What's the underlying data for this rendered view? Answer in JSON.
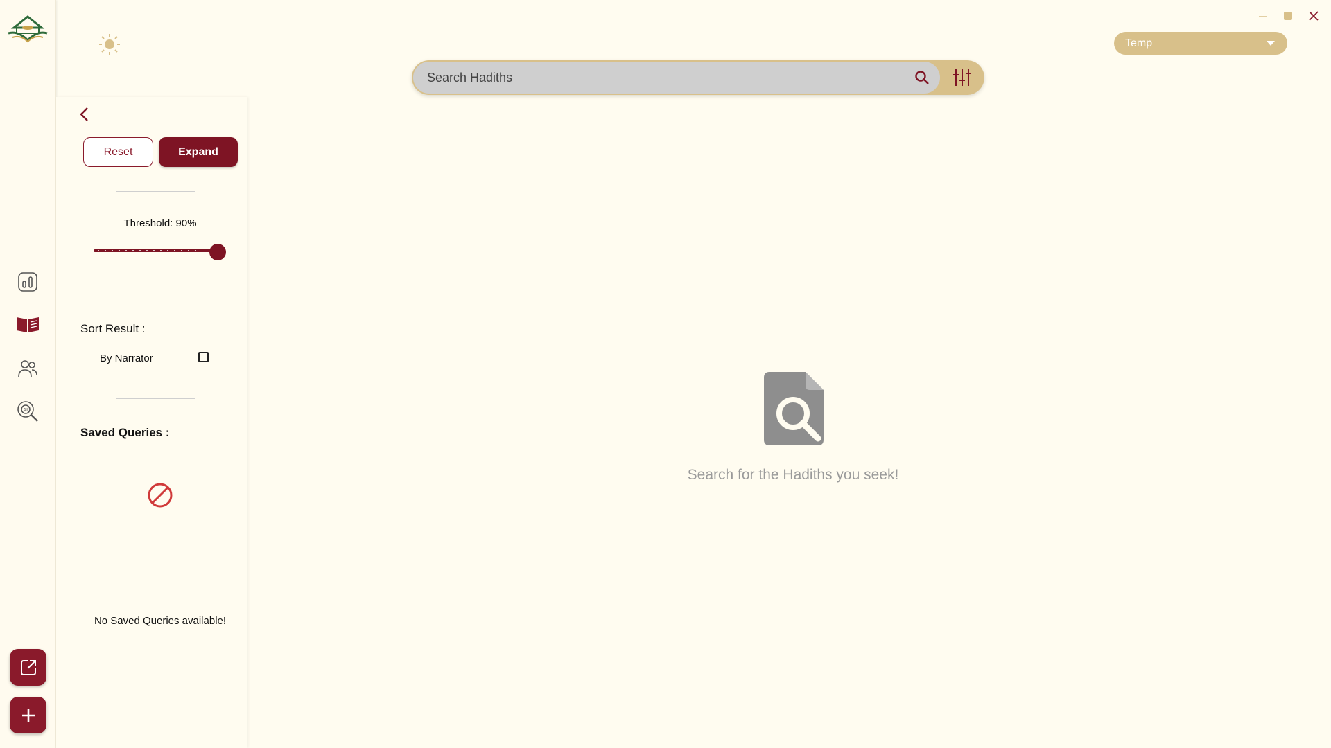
{
  "rail": {
    "items": [
      {
        "name": "statistics-icon"
      },
      {
        "name": "book-icon"
      },
      {
        "name": "narrators-icon"
      },
      {
        "name": "ai-search-icon"
      }
    ],
    "fab_open_icon": "external-link-icon",
    "fab_add_icon": "plus-icon"
  },
  "top": {
    "theme_icon": "sun-icon",
    "dropdown_value": "Temp"
  },
  "search": {
    "placeholder": "Search Hadiths"
  },
  "panel": {
    "reset_label": "Reset",
    "expand_label": "Expand",
    "threshold_label": "Threshold: 90%",
    "threshold_value": 0.9,
    "sort_title": "Sort Result :",
    "by_narrator_label": "By Narrator",
    "by_narrator_checked": false,
    "saved_title": "Saved Queries :",
    "no_saved_text": "No Saved Queries available!"
  },
  "empty_state": {
    "icon": "document-search-icon",
    "text": "Search for the Hadiths you seek!"
  },
  "colors": {
    "accent": "#7e1424",
    "gold": "#d8c08a",
    "background": "#fffcf0"
  }
}
